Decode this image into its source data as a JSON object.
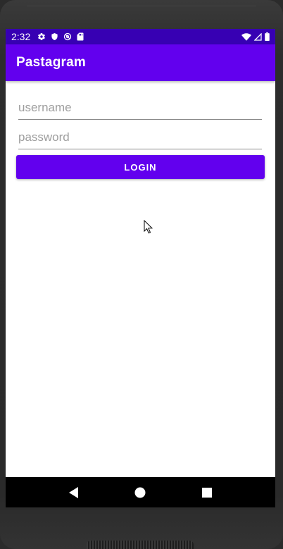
{
  "status_bar": {
    "time": "2:32",
    "left_icons": [
      "settings-icon",
      "shield-icon",
      "sync-icon",
      "sd-card-icon"
    ],
    "right_icons": [
      "wifi-icon",
      "signal-icon",
      "battery-icon"
    ],
    "background": "#3700b3"
  },
  "app_bar": {
    "title": "Pastagram",
    "background": "#6200ee"
  },
  "login_form": {
    "username_placeholder": "username",
    "username_value": "",
    "password_placeholder": "password",
    "password_value": "",
    "login_label": "LOGIN",
    "accent": "#6200ee"
  },
  "nav_bar": {
    "buttons": [
      "back-icon",
      "home-icon",
      "recents-icon"
    ]
  }
}
